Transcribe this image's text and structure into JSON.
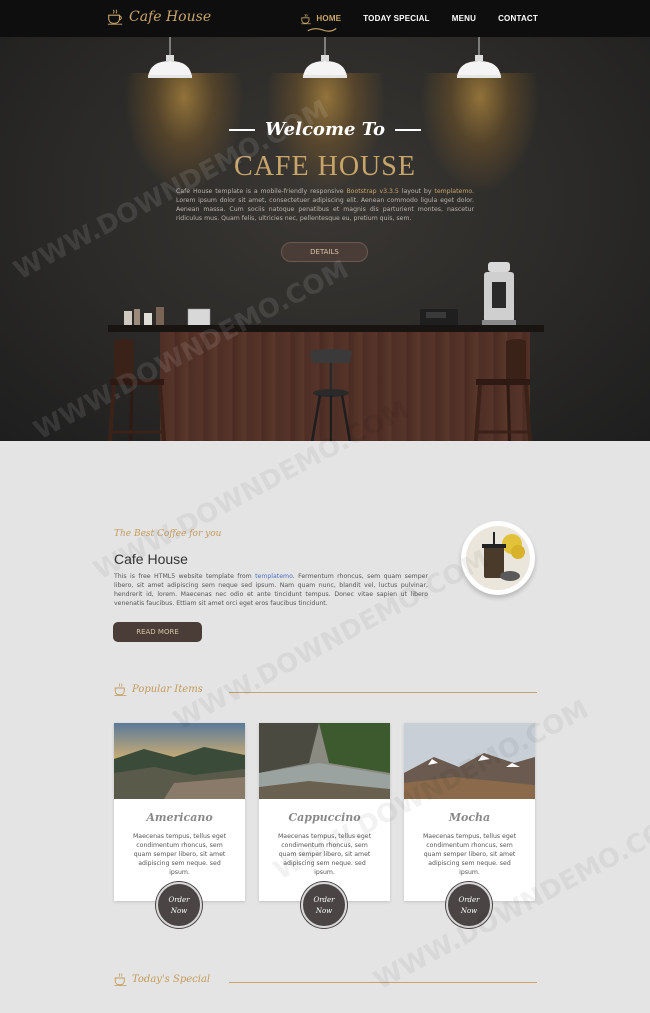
{
  "brand": {
    "name": "Cafe House"
  },
  "nav": {
    "items": [
      "HOME",
      "TODAY SPECIAL",
      "MENU",
      "CONTACT"
    ]
  },
  "hero": {
    "welcome": "Welcome To",
    "title": "CAFE HOUSE",
    "desc_parts": [
      "Cafe House template is a mobile-friendly responsive ",
      "Bootstrap v3.3.5",
      " layout by ",
      "templatemo",
      ". Lorem ipsum dolor sit amet, consectetuer adipiscing elit. Aenean commodo ligula eget dolor. Aenean massa. Cum sociis natoque penatibus et magnis dis parturient montes, nascetur ridiculus mus. Quam felis, ultricies nec, pellentesque eu, pretium quis, sem."
    ],
    "details_label": "DETAILS"
  },
  "about": {
    "subtitle": "The Best Coffee for you",
    "title": "Cafe House",
    "text_parts": [
      "This is free HTML5 website template from ",
      "templatemo",
      ". Fermentum rhoncus, sem quam semper libero, sit amet adipiscing sem neque sed ipsum. Nam quam nunc, blandit vel, luctus pulvinar, hendrerit id, lorem. Maecenas nec odio et ante tincidunt tempus. Donec vitae sapien ut libero venenatis faucibus. Ettiam sit amet orci eget eros faucibus tincidunt."
    ],
    "button": "READ MORE"
  },
  "popular": {
    "heading": "Popular Items",
    "cards": [
      {
        "title": "Americano",
        "text": "Maecenas tempus, tellus eget condimentum rhoncus, sem quam semper libero, sit amet adipiscing sem neque. sed ipsum.",
        "order": "Order",
        "order2": "Now"
      },
      {
        "title": "Cappuccino",
        "text": "Maecenas tempus, tellus eget condimentum rhoncus, sem quam semper libero, sit amet adipiscing sem neque. sed ipsum.",
        "order": "Order",
        "order2": "Now"
      },
      {
        "title": "Mocha",
        "text": "Maecenas tempus, tellus eget condimentum rhoncus, sem quam semper libero, sit amet adipiscing sem neque. sed ipsum.",
        "order": "Order",
        "order2": "Now"
      }
    ]
  },
  "special": {
    "heading": "Today's Special"
  },
  "watermark": "WWW.DOWNDEMO.COM",
  "colors": {
    "accent": "#c8a56a",
    "dark": "#0e0e0e",
    "button": "#4a3c36"
  }
}
